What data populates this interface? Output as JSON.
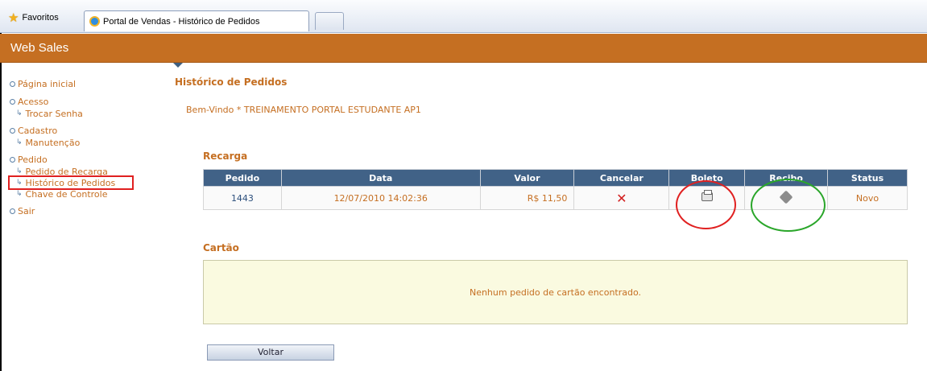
{
  "browser": {
    "favorites_label": "Favoritos",
    "tab_title": "Portal de Vendas - Histórico de Pedidos"
  },
  "app": {
    "title": "Web Sales"
  },
  "sidebar": {
    "groups": [
      {
        "label": "Página inicial",
        "items": []
      },
      {
        "label": "Acesso",
        "items": [
          {
            "label": "Trocar Senha"
          }
        ]
      },
      {
        "label": "Cadastro",
        "items": [
          {
            "label": "Manutenção"
          }
        ]
      },
      {
        "label": "Pedido",
        "items": [
          {
            "label": "Pedido de Recarga"
          },
          {
            "label": "Histórico de Pedidos",
            "active": true
          },
          {
            "label": "Chave de Controle"
          }
        ]
      },
      {
        "label": "Sair",
        "items": []
      }
    ]
  },
  "main": {
    "page_title": "Histórico de Pedidos",
    "welcome": "Bem-Vindo * TREINAMENTO PORTAL ESTUDANTE AP1",
    "recarga": {
      "title": "Recarga",
      "columns": [
        "Pedido",
        "Data",
        "Valor",
        "Cancelar",
        "Boleto",
        "Recibo",
        "Status"
      ],
      "rows": [
        {
          "pedido": "1443",
          "data": "12/07/2010 14:02:36",
          "valor": "R$ 11,50",
          "status": "Novo"
        }
      ]
    },
    "cartao": {
      "title": "Cartão",
      "empty_message": "Nenhum pedido de cartão encontrado."
    },
    "back_button": "Voltar"
  },
  "colors": {
    "header_orange": "#c56f22",
    "table_header_blue": "#416287",
    "annotation_red": "#e02020",
    "annotation_green": "#2aa62a"
  }
}
